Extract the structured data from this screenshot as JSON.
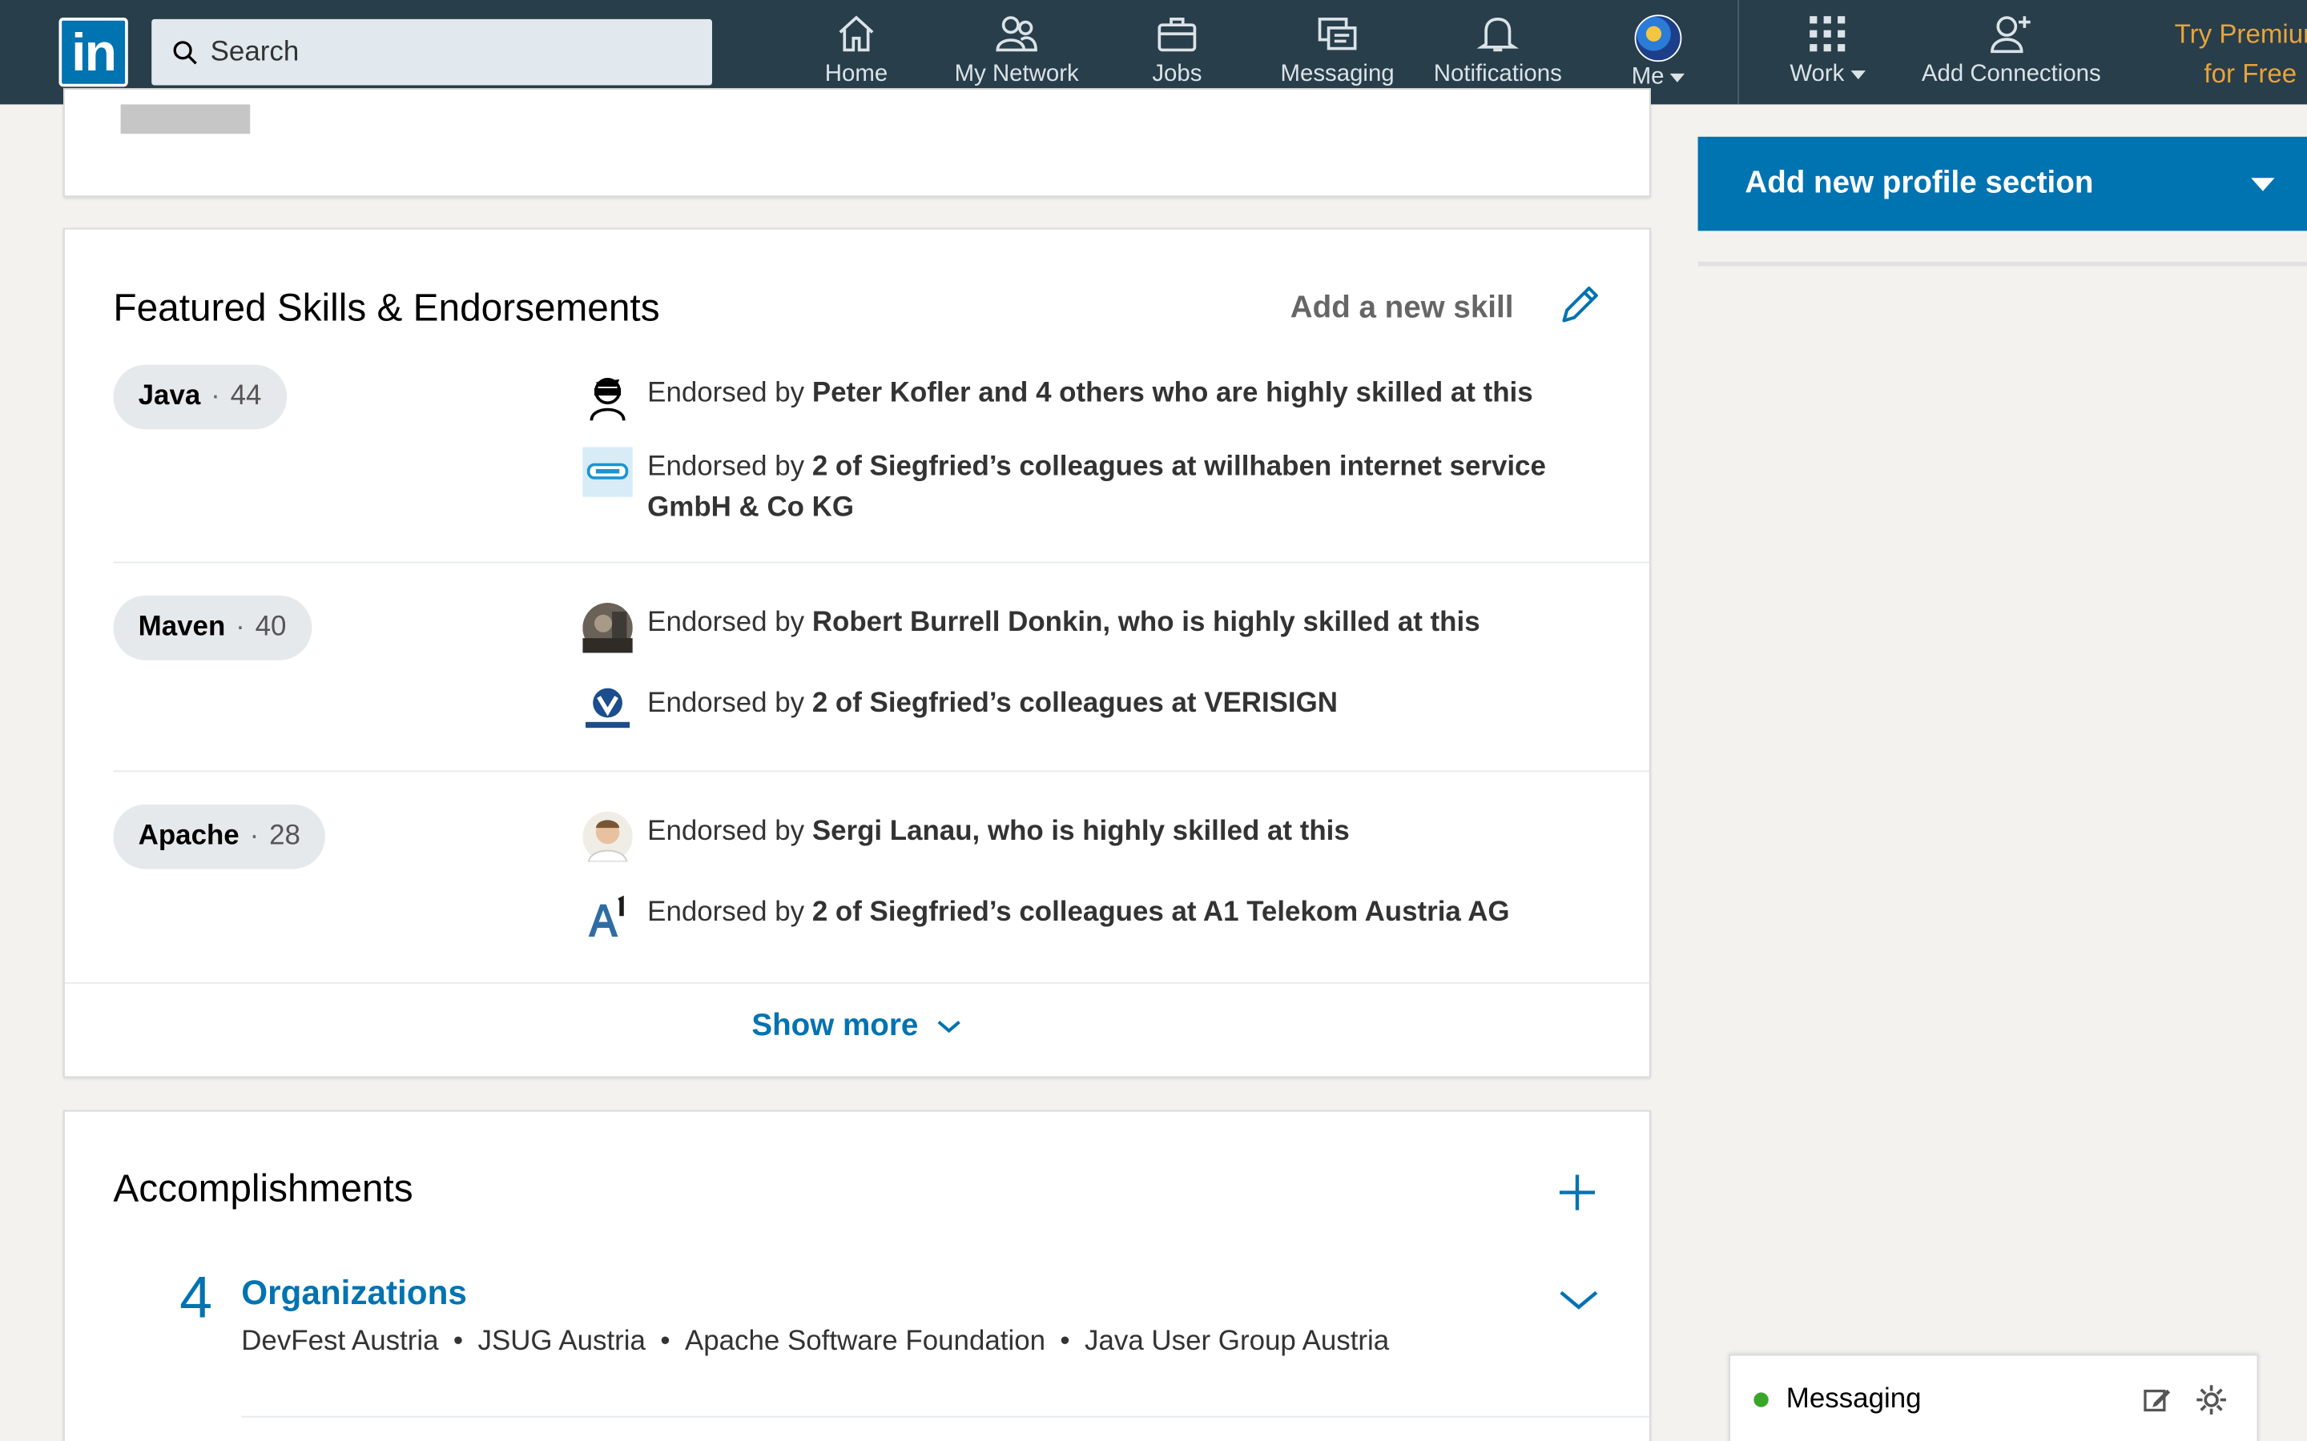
{
  "nav": {
    "logo_text": "in",
    "search_placeholder": "Search",
    "items": [
      {
        "label": "Home",
        "icon": "home-icon"
      },
      {
        "label": "My Network",
        "icon": "network-icon"
      },
      {
        "label": "Jobs",
        "icon": "briefcase-icon"
      },
      {
        "label": "Messaging",
        "icon": "messaging-icon"
      },
      {
        "label": "Notifications",
        "icon": "bell-icon"
      },
      {
        "label": "Me",
        "icon": "avatar"
      },
      {
        "label": "Work",
        "icon": "grid-icon"
      },
      {
        "label": "Add Connections",
        "icon": "add-person-icon"
      }
    ],
    "premium_line1": "Try Premium",
    "premium_line2": "for Free"
  },
  "skills": {
    "title": "Featured Skills & Endorsements",
    "add_skill": "Add a new skill",
    "rows": [
      {
        "name": "Java",
        "dot": "·",
        "count": "44",
        "endorsements": [
          {
            "prefix": "Endorsed by ",
            "bold": "Peter Kofler and 4 others who are highly skilled at this"
          },
          {
            "prefix": "Endorsed by ",
            "bold": "2 of Siegfried’s colleagues at willhaben internet service GmbH & Co KG"
          }
        ]
      },
      {
        "name": "Maven",
        "dot": "·",
        "count": "40",
        "endorsements": [
          {
            "prefix": "Endorsed by ",
            "bold": "Robert Burrell Donkin, who is highly skilled at this"
          },
          {
            "prefix": "Endorsed by ",
            "bold": "2 of Siegfried’s colleagues at VERISIGN"
          }
        ]
      },
      {
        "name": "Apache",
        "dot": "·",
        "count": "28",
        "endorsements": [
          {
            "prefix": "Endorsed by ",
            "bold": "Sergi Lanau, who is highly skilled at this"
          },
          {
            "prefix": "Endorsed by ",
            "bold": "2 of Siegfried’s colleagues at A1 Telekom Austria AG"
          }
        ]
      }
    ],
    "show_more": "Show more"
  },
  "accomplishments": {
    "title": "Accomplishments",
    "count": "4",
    "section": "Organizations",
    "items": [
      "DevFest Austria",
      "JSUG Austria",
      "Apache Software Foundation",
      "Java User Group Austria"
    ],
    "separator": "•"
  },
  "sidebar": {
    "add_section": "Add new profile section"
  },
  "messaging_dock": {
    "label": "Messaging"
  },
  "colors": {
    "nav_bg": "#283e4a",
    "brand_blue": "#0073b1",
    "premium_gold": "#e7a33e",
    "online_green": "#3aa629"
  }
}
